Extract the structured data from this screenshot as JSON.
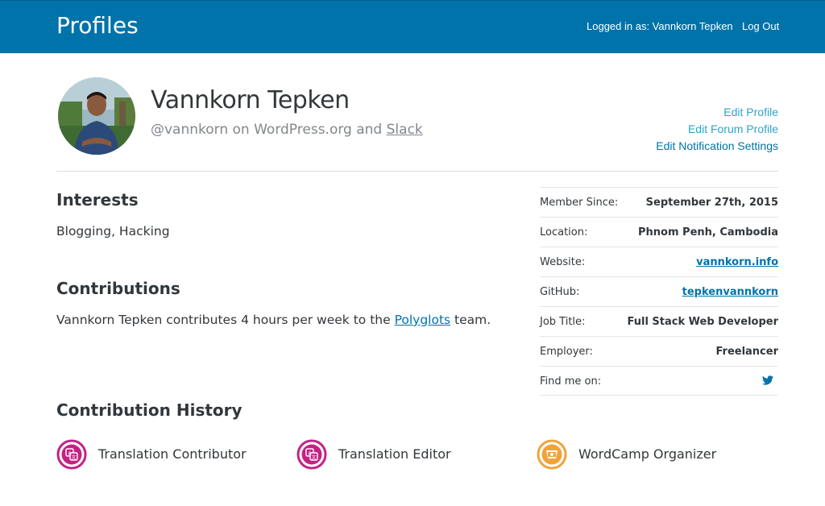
{
  "header": {
    "site_title": "Profiles",
    "logged_in_text": "Logged in as: Vannkorn Tepken",
    "logout_label": "Log Out",
    "bg_color": "#0073aa"
  },
  "profile": {
    "name": "Vannkorn Tepken",
    "handle_text": "@vannkorn on WordPress.org and ",
    "slack_label": "Slack"
  },
  "edit_links": {
    "edit_profile": "Edit Profile",
    "edit_forum_profile": "Edit Forum Profile",
    "edit_notification_settings": "Edit Notification Settings"
  },
  "interests": {
    "heading": "Interests",
    "text": "Blogging, Hacking"
  },
  "contributions": {
    "heading": "Contributions",
    "text_before": "Vannkorn Tepken contributes 4 hours per week to the ",
    "team_link": "Polyglots",
    "text_after": " team."
  },
  "meta": [
    {
      "label": "Member Since:",
      "value": "September 27th, 2015"
    },
    {
      "label": "Location:",
      "value": "Phnom Penh, Cambodia"
    },
    {
      "label": "Website:",
      "value": "vannkorn.info"
    },
    {
      "label": "GitHub:",
      "value": "tepkenvannkorn"
    },
    {
      "label": "Job Title:",
      "value": "Full Stack Web Developer"
    },
    {
      "label": "Employer:",
      "value": "Freelancer"
    },
    {
      "label": "Find me on:",
      "value_icon": "twitter-icon"
    }
  ],
  "contribution_history": {
    "heading": "Contribution History",
    "badges": [
      {
        "label": "Translation Contributor",
        "icon": "translation-icon",
        "color": "#c32283"
      },
      {
        "label": "Translation Editor",
        "icon": "translation-icon",
        "color": "#c32283"
      },
      {
        "label": "WordCamp Organizer",
        "icon": "wordcamp-icon",
        "color": "#f0a33b"
      }
    ]
  }
}
